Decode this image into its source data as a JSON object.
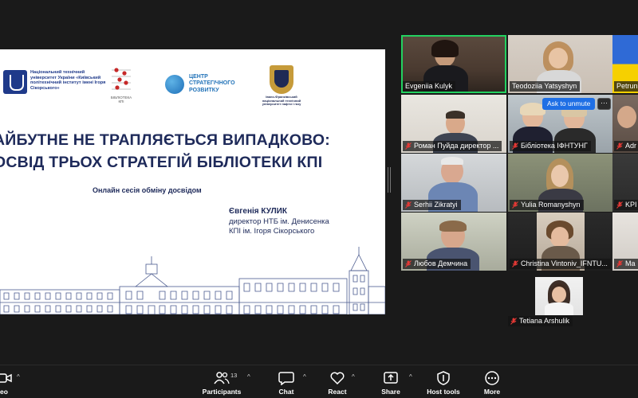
{
  "slide": {
    "logo_kpi_text": "Національний технічний університет України «Київський політехнічний інститут імені Ігоря Сікорського»",
    "logo_lib_text": "БІБЛІОТЕКА КПІ",
    "logo_center_text": "ЦЕНТР СТРАТЕГІЧНОГО РОЗВИТКУ",
    "logo_ifntung_text": "Івано-Франківський національний технічний університет нафти і газу",
    "title_line1": "АЙБУТНЕ НЕ ТРАПЛЯЄТЬСЯ ВИПАДКОВО:",
    "title_line2": "ОСВІД ТРЬОХ СТРАТЕГІЙ БІБЛІОТЕКИ КПІ",
    "subtitle": "Онлайн сесія обміну досвідом",
    "author_name": "Євгенія КУЛИК",
    "author_role1": "директор НТБ ім. Денисенка",
    "author_role2": "КПІ ім. Ігоря Сікорського"
  },
  "gallery": {
    "tiles": [
      {
        "name": "Evgeniia Kulyk",
        "muted": false,
        "active": true
      },
      {
        "name": "Teodoziia Yatsyshyn",
        "muted": false,
        "active": false
      },
      {
        "name": "Petrun",
        "muted": false,
        "active": false
      },
      {
        "name": "Роман Пуйда директор ...",
        "muted": true,
        "active": false
      },
      {
        "name": "Бібліотека ІФНТУНГ",
        "muted": true,
        "active": false
      },
      {
        "name": "Adr",
        "muted": true,
        "active": false
      },
      {
        "name": "Serhii Zikratyi",
        "muted": true,
        "active": false
      },
      {
        "name": "Yulia Romanyshyn",
        "muted": true,
        "active": false
      },
      {
        "name": "KPI",
        "muted": true,
        "active": false
      },
      {
        "name": "Любов Демчина",
        "muted": true,
        "active": false
      },
      {
        "name": "Christina Vintoniv_IFNTU...",
        "muted": true,
        "active": false
      },
      {
        "name": "Ma",
        "muted": true,
        "active": false
      },
      {
        "name": "Tetiana Arshulik",
        "muted": true,
        "active": false
      }
    ],
    "ask_to_unmute": "Ask to unmute",
    "more_options": "···"
  },
  "toolbar": {
    "video_label": "eo",
    "participants_label": "Participants",
    "participants_count": "13",
    "chat_label": "Chat",
    "react_label": "React",
    "share_label": "Share",
    "host_tools_label": "Host tools",
    "more_label": "More"
  },
  "colors": {
    "active_speaker": "#23d160",
    "muted_red": "#e53935",
    "unmute_blue": "#1f6fe5",
    "slide_text": "#1e2a5a"
  }
}
